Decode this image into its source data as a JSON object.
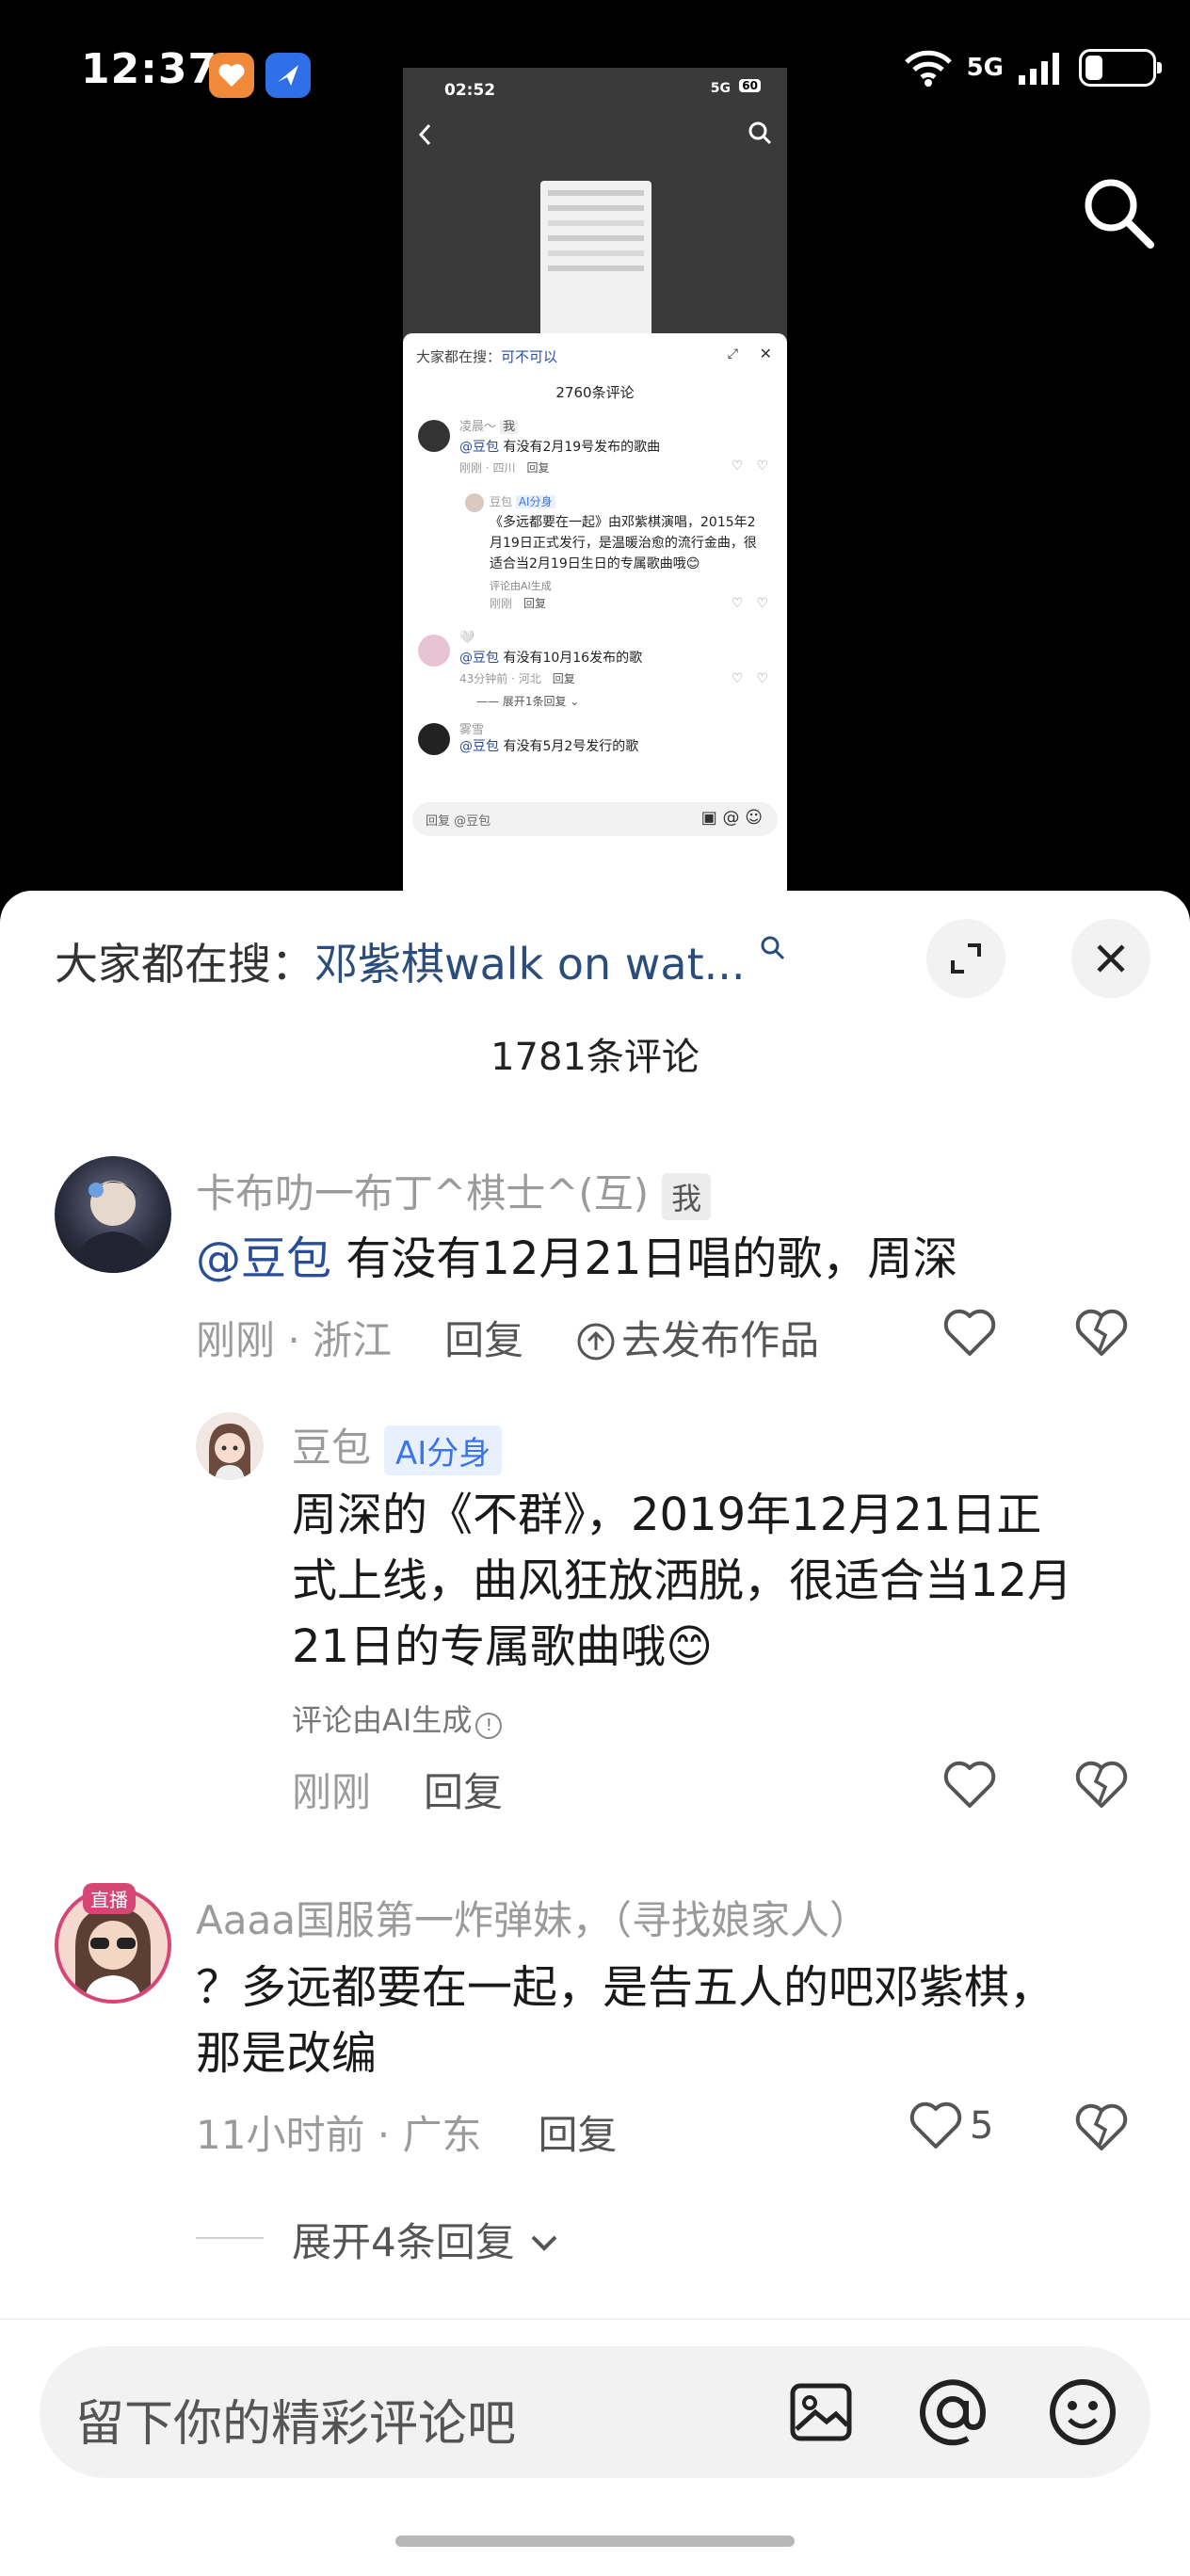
{
  "status": {
    "time": "12:37",
    "network": "5G"
  },
  "video": {
    "time": "02:52",
    "network": "5G",
    "battery": "60",
    "search_prefix": "大家都在搜：",
    "search_term": "可不可以",
    "count": "2760条评论",
    "comments": [
      {
        "name": "凌晨～",
        "tag": "我",
        "mention": "@豆包",
        "text": "有没有2月19号发布的歌曲",
        "meta": "刚刚 · 四川",
        "reply": "回复"
      },
      {
        "name": "豆包",
        "tag": "AI分身",
        "text": "《多远都要在一起》由邓紫棋演唱，2015年2月19日正式发行，是温暖治愈的流行金曲，很适合当2月19日生日的专属歌曲哦😊",
        "note": "评论由AI生成",
        "meta": "刚刚",
        "reply": "回复"
      },
      {
        "name": "🤍",
        "mention": "@豆包",
        "text": "有没有10月16发布的歌",
        "meta": "43分钟前 · 河北",
        "reply": "回复",
        "expand": "展开1条回复"
      },
      {
        "name": "雾雪",
        "mention": "@豆包",
        "text": "有没有5月2号发行的歌"
      }
    ],
    "input_placeholder": "回复 @豆包"
  },
  "sheet": {
    "search_prefix": "大家都在搜：",
    "search_term": "邓紫棋walk on wat...",
    "count": "1781条评论",
    "comments": [
      {
        "name": "卡布叻一布丁^棋士^(互)",
        "tag": "我",
        "mention": "@豆包",
        "text": " 有没有12月21日唱的歌，周深",
        "time": "刚刚 · 浙江",
        "reply": "回复",
        "publish": "去发布作品"
      },
      {
        "name": "豆包",
        "tag": "AI分身",
        "lines": [
          "周深的《不群》，2019年12月21日正",
          "式上线，曲风狂放洒脱，很适合当12月",
          "21日的专属歌曲哦😊"
        ],
        "note": "评论由AI生成",
        "time": "刚刚",
        "reply": "回复"
      },
      {
        "name": "Aaaa国服第一炸弹妹，（寻找娘家人）",
        "live": "直播",
        "lines": [
          "？多远都要在一起，是告五人的吧邓紫棋，",
          "那是改编"
        ],
        "time": "11小时前 · 广东",
        "reply": "回复",
        "likes": "5",
        "expand": "展开4条回复"
      }
    ],
    "input_placeholder": "留下你的精彩评论吧"
  },
  "colors": {
    "mention": "#2a4d9a",
    "search_term": "#2a4d7d",
    "ai_tag": "#3b74e8"
  }
}
